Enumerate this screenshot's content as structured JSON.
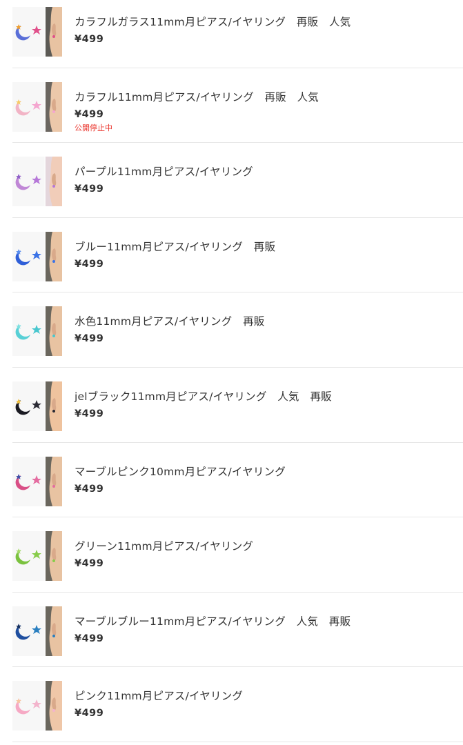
{
  "items": [
    {
      "title": "カラフルガラス11mm月ピアス/イヤリング　再販　人気",
      "price": "¥499",
      "status": "",
      "colors": {
        "moon": "#5a6fd8",
        "star1": "#e0508a",
        "star2": "#f0a030",
        "ear_bg": "#5c5a55",
        "skin": "#e8c3a2"
      }
    },
    {
      "title": "カラフル11mm月ピアス/イヤリング　再販　人気",
      "price": "¥499",
      "status": "公開停止中",
      "colors": {
        "moon": "#f2b4c6",
        "star1": "#f5a6d0",
        "star2": "#f6cc66",
        "ear_bg": "#6b6660",
        "skin": "#ecc8aa"
      }
    },
    {
      "title": "パープル11mm月ピアス/イヤリング",
      "price": "¥499",
      "status": "",
      "colors": {
        "moon": "#c087d6",
        "star1": "#b678d8",
        "star2": "#8f60c8",
        "ear_bg": "#e4d6dc",
        "skin": "#f1cdb9"
      }
    },
    {
      "title": "ブルー11mm月ピアス/イヤリング　再販",
      "price": "¥499",
      "status": "",
      "colors": {
        "moon": "#2f5fd8",
        "star1": "#3b73e6",
        "star2": "#5a8ff0",
        "ear_bg": "#6a665d",
        "skin": "#e8c3a2"
      }
    },
    {
      "title": "水色11mm月ピアス/イヤリング　再販",
      "price": "¥499",
      "status": "",
      "colors": {
        "moon": "#58d0d6",
        "star1": "#48c7cf",
        "star2": "#7ee0e0",
        "ear_bg": "#6a665d",
        "skin": "#e8c3a2"
      }
    },
    {
      "title": "jelブラック11mm月ピアス/イヤリング　人気　再販",
      "price": "¥499",
      "status": "",
      "colors": {
        "moon": "#1a1a22",
        "star1": "#2a2a34",
        "star2": "#f0c040",
        "ear_bg": "#6a665d",
        "skin": "#efc39e"
      }
    },
    {
      "title": "マーブルピンク10mm月ピアス/イヤリング",
      "price": "¥499",
      "status": "",
      "colors": {
        "moon": "#d94f86",
        "star1": "#e46ca0",
        "star2": "#3f4fa8",
        "ear_bg": "#6a665d",
        "skin": "#e8c3a2"
      }
    },
    {
      "title": "グリーン11mm月ピアス/イヤリング",
      "price": "¥499",
      "status": "",
      "colors": {
        "moon": "#7bc23f",
        "star1": "#88cc4a",
        "star2": "#a6dc6a",
        "ear_bg": "#6a665d",
        "skin": "#e8c3a2"
      }
    },
    {
      "title": "マーブルブルー11mm月ピアス/イヤリング　人気　再販",
      "price": "¥499",
      "status": "",
      "colors": {
        "moon": "#1f4fa0",
        "star1": "#2a7fc0",
        "star2": "#16305e",
        "ear_bg": "#6a665d",
        "skin": "#e8c3a2"
      }
    },
    {
      "title": "ピンク11mm月ピアス/イヤリング",
      "price": "¥499",
      "status": "",
      "colors": {
        "moon": "#f6a9c4",
        "star1": "#f3b4cc",
        "star2": "#f7c6a2",
        "ear_bg": "#6a665d",
        "skin": "#efc7a8"
      }
    }
  ]
}
